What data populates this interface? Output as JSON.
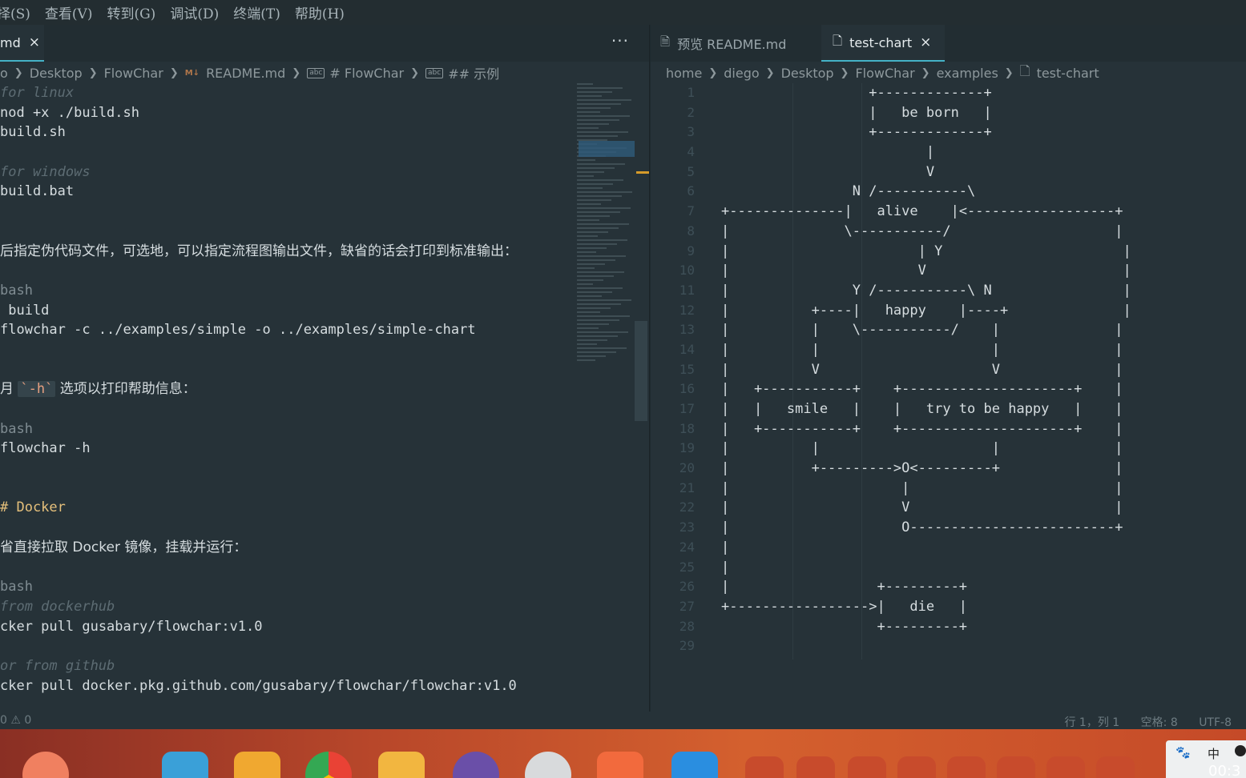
{
  "menu": [
    "择(S)",
    "查看(V)",
    "转到(G)",
    "调试(D)",
    "终端(T)",
    "帮助(H)"
  ],
  "left_editor": {
    "tab_label": "md",
    "tab_close": "×",
    "more_label": "···",
    "breadcrumb": [
      "o",
      "Desktop",
      "FlowChar",
      "README.md",
      "# FlowChar",
      "## 示例"
    ],
    "code_lines": [
      {
        "text": "for linux",
        "kind": "comment"
      },
      {
        "text": "nod +x ./build.sh",
        "kind": "code"
      },
      {
        "text": "build.sh",
        "kind": "code"
      },
      {
        "text": "",
        "kind": "code"
      },
      {
        "text": "for windows",
        "kind": "comment"
      },
      {
        "text": "build.bat",
        "kind": "code"
      },
      {
        "text": "",
        "kind": "code"
      },
      {
        "text": "",
        "kind": "code"
      },
      {
        "text": "后指定伪代码文件，可选地，可以指定流程图输出文件，缺省的话会打印到标准输出：",
        "kind": "cjk"
      },
      {
        "text": "",
        "kind": "code"
      },
      {
        "text": "bash",
        "kind": "comment-plain"
      },
      {
        "text": " build",
        "kind": "code"
      },
      {
        "text": "flowchar -c ../examples/simple -o ../examples/simple-chart",
        "kind": "code"
      },
      {
        "text": "",
        "kind": "code"
      },
      {
        "text": "",
        "kind": "code"
      },
      {
        "text": "",
        "kind": "help"
      },
      {
        "text": "",
        "kind": "code"
      },
      {
        "text": "bash",
        "kind": "comment-plain"
      },
      {
        "text": "flowchar -h",
        "kind": "code"
      },
      {
        "text": "",
        "kind": "code"
      },
      {
        "text": "",
        "kind": "code"
      },
      {
        "text": "# Docker",
        "kind": "heading"
      },
      {
        "text": "",
        "kind": "code"
      },
      {
        "text": "省直接拉取 Docker 镜像，挂载并运行：",
        "kind": "cjk"
      },
      {
        "text": "",
        "kind": "code"
      },
      {
        "text": "bash",
        "kind": "comment-plain"
      },
      {
        "text": "from dockerhub",
        "kind": "comment"
      },
      {
        "text": "cker pull gusabary/flowchar:v1.0",
        "kind": "code"
      },
      {
        "text": "",
        "kind": "code"
      },
      {
        "text": "or from github",
        "kind": "comment"
      },
      {
        "text": "cker pull docker.pkg.github.com/gusabary/flowchar/flowchar:v1.0",
        "kind": "code"
      }
    ],
    "help_line": {
      "prefix": "月 ",
      "code": "`-h`",
      "suffix": " 选项以打印帮助信息："
    }
  },
  "right_editor": {
    "tabs": [
      {
        "label": "预览 README.md",
        "active": false
      },
      {
        "label": "test-chart",
        "active": true,
        "close": "×"
      }
    ],
    "breadcrumb": [
      "home",
      "diego",
      "Desktop",
      "FlowChar",
      "examples",
      "test-chart"
    ],
    "line_numbers": [
      "1",
      "2",
      "3",
      "4",
      "5",
      "6",
      "7",
      "8",
      "9",
      "10",
      "11",
      "12",
      "13",
      "14",
      "15",
      "16",
      "17",
      "18",
      "19",
      "20",
      "21",
      "22",
      "23",
      "24",
      "25",
      "26",
      "27",
      "28",
      "29"
    ],
    "chart_lines": [
      "                  +-------------+",
      "                  |   be born   |",
      "                  +-------------+",
      "                         |",
      "                         V",
      "                N /-----------\\",
      "+--------------|   alive    |<------------------+",
      "|              \\-----------/                    |",
      "|                       | Y                      |",
      "|                       V                        |",
      "|               Y /-----------\\ N                |",
      "|          +----|   happy    |----+              |",
      "|          |    \\-----------/    |              |",
      "|          |                     |              |",
      "|          V                     V              |",
      "|   +-----------+    +---------------------+    |",
      "|   |   smile   |    |   try to be happy   |    |",
      "|   +-----------+    +---------------------+    |",
      "|          |                     |              |",
      "|          +--------->O<---------+              |",
      "|                     |                         |",
      "|                     V                         |",
      "|                     O-------------------------+",
      "|",
      "|",
      "|                  +---------+",
      "+----------------->|   die   |",
      "                   +---------+",
      ""
    ]
  },
  "status": {
    "left": "0 ⚠ 0",
    "position": "行 1，列 1",
    "spaces": "空格: 8",
    "encoding": "UTF-8"
  },
  "tray": {
    "ime": "中",
    "clock": "00:3"
  },
  "dock_icons": [
    "app-icon",
    "files-icon",
    "store-icon",
    "chrome-icon",
    "photos-icon",
    "music-icon",
    "settings-icon",
    "slides-icon",
    "vscode-icon"
  ],
  "colors": {
    "accent": "#44b2c6",
    "editor_bg": "#263238",
    "heading": "#e5c07b"
  }
}
